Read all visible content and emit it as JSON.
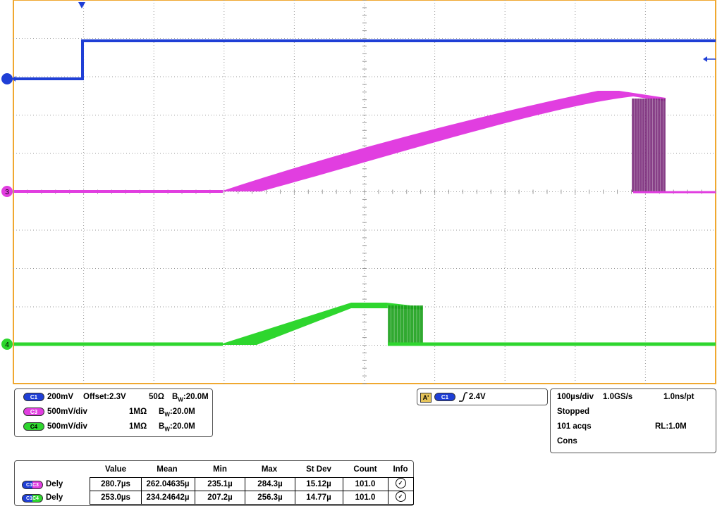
{
  "channels": [
    {
      "id": "C1",
      "scale": "200mV",
      "offset": "Offset:2.3V",
      "impedance": "50Ω",
      "bw": "20.0M",
      "color": "#1f3fd6",
      "marker": ""
    },
    {
      "id": "C3",
      "scale": "500mV/div",
      "offset": "",
      "impedance": "1MΩ",
      "bw": "20.0M",
      "color": "#e13ee0",
      "marker": "3"
    },
    {
      "id": "C4",
      "scale": "500mV/div",
      "offset": "",
      "impedance": "1MΩ",
      "bw": "20.0M",
      "color": "#2ed62e",
      "marker": "4"
    }
  ],
  "bw_prefix": "B",
  "bw_sub": "W",
  "bw_sep": ":",
  "trigger": {
    "badge": "A'",
    "source": "C1",
    "level": "2.4V"
  },
  "timebase": {
    "timediv": "100µs/div",
    "rate": "1.0GS/s",
    "ptres": "1.0ns/pt",
    "state": "Stopped",
    "acqs": "101 acqs",
    "rl": "RL:1.0M",
    "mode": "Cons"
  },
  "measurements": {
    "headers": [
      "",
      "Value",
      "Mean",
      "Min",
      "Max",
      "St Dev",
      "Count",
      "Info"
    ],
    "rows": [
      {
        "src1": "C1",
        "src2": "C3",
        "name": "Dely",
        "value": "280.7µs",
        "mean": "262.04635µ",
        "min": "235.1µ",
        "max": "284.3µ",
        "stdev": "15.12µ",
        "count": "101.0"
      },
      {
        "src1": "C1",
        "src2": "C4",
        "name": "Dely",
        "value": "253.0µs",
        "mean": "234.24642µ",
        "min": "207.2µ",
        "max": "256.3µ",
        "stdev": "14.77µ",
        "count": "101.0"
      }
    ]
  },
  "colors": {
    "frame": "#f0a830",
    "ch1": "#1f3fd6",
    "ch3": "#e13ee0",
    "ch3_dark": "#7a2a7a",
    "ch4": "#2ed62e",
    "ch4_dark": "#1aa01a"
  }
}
